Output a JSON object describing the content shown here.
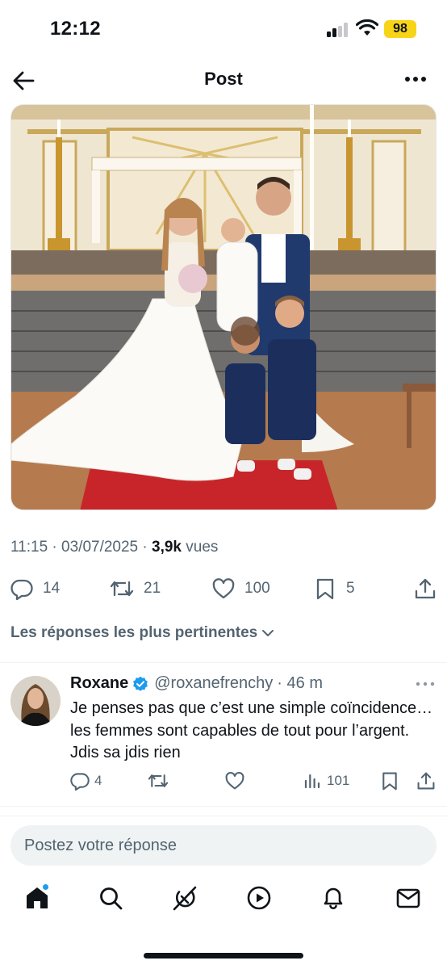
{
  "status_bar": {
    "time": "12:12",
    "battery": "98",
    "battery_color": "#f7d418"
  },
  "header": {
    "title": "Post",
    "back_icon": "arrow-left-icon",
    "more_icon": "ellipsis-icon"
  },
  "post": {
    "image_alt": "Wedding photo: bride, groom holding a baby, and two little boys in suits in front of a church altar",
    "time": "11:15",
    "date": "03/07/2025",
    "views_count": "3,9k",
    "views_label": "vues",
    "actions": {
      "replies": "14",
      "reposts": "21",
      "likes": "100",
      "bookmarks": "5"
    }
  },
  "replies_sort": {
    "label": "Les réponses les plus pertinentes"
  },
  "reply": {
    "name": "Roxane",
    "handle": "@roxanefrenchy",
    "time": "· 46 m",
    "text": "Je penses pas que c’est une simple coïncidence… les femmes sont capables de tout pour l’argent. Jdis sa jdis rien",
    "counts": {
      "replies": "4",
      "views": "101"
    }
  },
  "compose": {
    "placeholder": "Postez votre réponse"
  },
  "tabbar": {
    "items": [
      "home-icon",
      "search-icon",
      "grok-icon",
      "video-icon",
      "notifications-icon",
      "messages-icon"
    ]
  },
  "colors": {
    "accent": "#1d9bf0",
    "text_primary": "#0f1419",
    "text_secondary": "#536471"
  }
}
